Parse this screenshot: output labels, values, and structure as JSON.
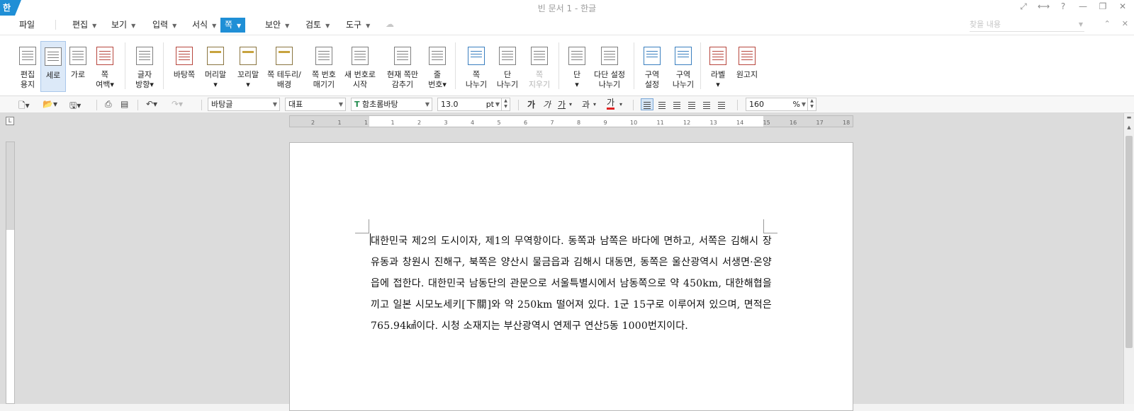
{
  "app": {
    "logo": "한",
    "title": "빈 문서 1 - 한글"
  },
  "title_icons": [
    "⤢",
    "⟷",
    "?",
    "—",
    "❐",
    "✕"
  ],
  "menu": {
    "file": "파일",
    "items": [
      {
        "label": "편집"
      },
      {
        "label": "보기"
      },
      {
        "label": "입력"
      },
      {
        "label": "서식"
      },
      {
        "label": "쪽",
        "active": true
      },
      {
        "label": "보안"
      },
      {
        "label": "검토"
      },
      {
        "label": "도구"
      }
    ],
    "search_placeholder": "찾을 내용"
  },
  "ribbon": [
    {
      "label": "편집\n용지"
    },
    {
      "label": "세로",
      "selected": true
    },
    {
      "label": "가로"
    },
    {
      "label": "쪽\n여백▾"
    },
    {
      "label": "글자\n방향▾"
    },
    {
      "label": "바탕쪽"
    },
    {
      "label": "머리말\n▾"
    },
    {
      "label": "꼬리말\n▾"
    },
    {
      "label": "쪽 테두리/\n배경"
    },
    {
      "label": "쪽 번호\n매기기"
    },
    {
      "label": "새 번호로\n시작"
    },
    {
      "label": "현재 쪽만\n감추기"
    },
    {
      "label": "줄\n번호▾"
    },
    {
      "label": "쪽\n나누기"
    },
    {
      "label": "단\n나누기"
    },
    {
      "label": "쪽\n지우기",
      "disabled": true
    },
    {
      "label": "단\n▾"
    },
    {
      "label": "다단 설정\n나누기"
    },
    {
      "label": "구역\n설정"
    },
    {
      "label": "구역\n나누기"
    },
    {
      "label": "라벨\n▾"
    },
    {
      "label": "원고지"
    }
  ],
  "toolbar": {
    "style": "바탕글",
    "font_lang": "대표",
    "font_icon": "T",
    "font": "함초롬바탕",
    "size": "13.0",
    "size_unit": "pt",
    "fmt_bold": "가",
    "fmt_italic": "가",
    "fmt_underline": "가",
    "fmt_strike": "과",
    "fmt_color": "가",
    "zoom": "160",
    "zoom_unit": "%"
  },
  "ruler": {
    "h_ticks": [
      "2",
      "1",
      "1",
      "1",
      "2",
      "3",
      "4",
      "5",
      "6",
      "7",
      "8",
      "9",
      "10",
      "11",
      "12",
      "13",
      "14",
      "15",
      "16",
      "17",
      "18"
    ]
  },
  "document": {
    "body": "대한민국 제2의 도시이자, 제1의 무역항이다. 동쪽과 남쪽은 바다에 면하고, 서쪽은 김해시 장유동과 창원시 진해구, 북쪽은 양산시 물금읍과 김해시 대동면, 동쪽은 울산광역시 서생면·온양읍에 접한다. 대한민국 남동단의 관문으로 서울특별시에서 남동쪽으로 약 450km, 대한해협을 끼고 일본 시모노세키[下關]와 약 250km 떨어져 있다. 1군 15구로 이루어져 있으며, 면적은 765.94㎢이다. 시청 소재지는 부산광역시 연제구 연산5동 1000번지이다."
  }
}
